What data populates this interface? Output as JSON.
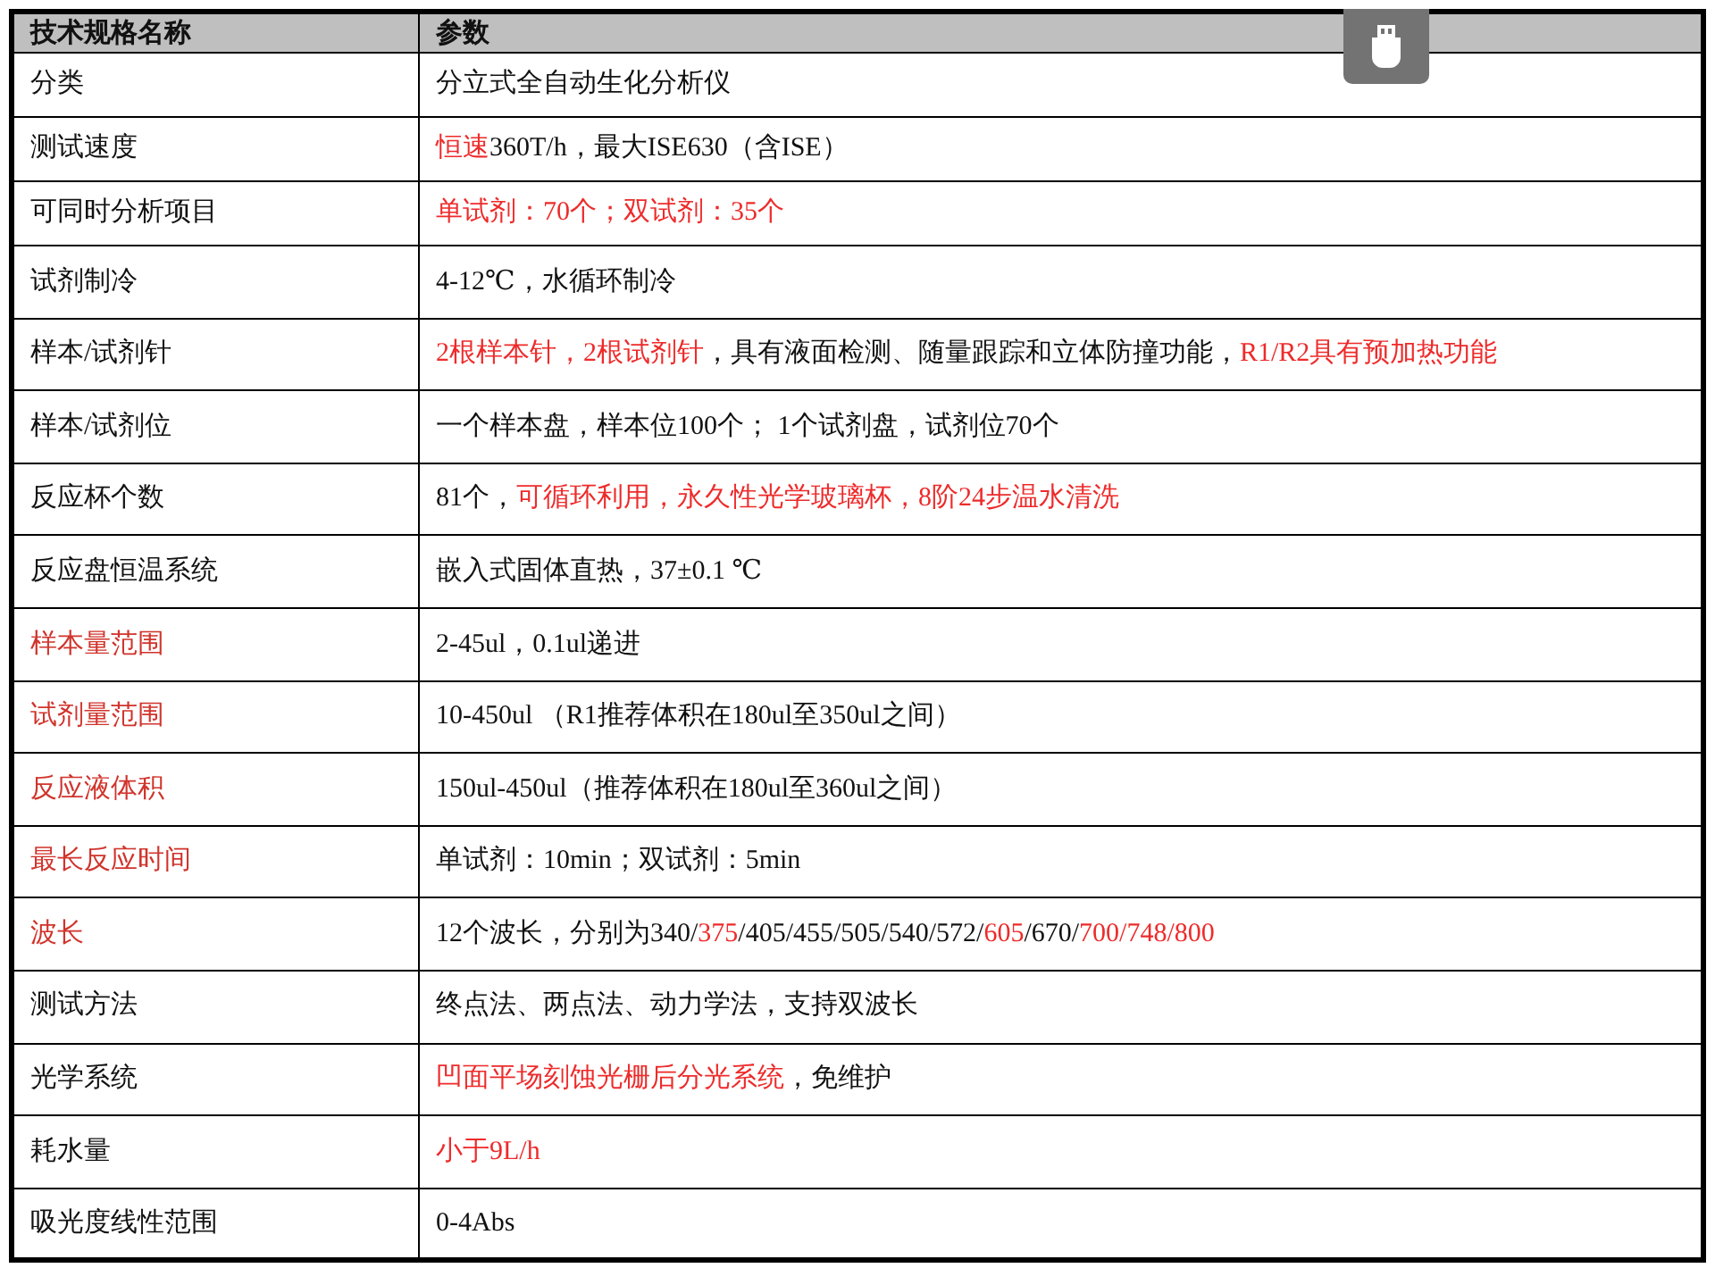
{
  "table": {
    "columns": [
      "技术规格名称",
      "参数"
    ],
    "rows": [
      [
        [
          {
            "text": "分类",
            "highlight": false
          }
        ],
        [
          {
            "text": "分立式全自动生化分析仪",
            "highlight": false
          }
        ]
      ],
      [
        [
          {
            "text": "测试速度",
            "highlight": false
          }
        ],
        [
          {
            "text": "恒速",
            "highlight": true
          },
          {
            "text": "360T/h，最大ISE630（含ISE）",
            "highlight": false
          }
        ]
      ],
      [
        [
          {
            "text": "可同时分析项目",
            "highlight": false
          }
        ],
        [
          {
            "text": "单试剂：70个；双试剂：35个",
            "highlight": true
          }
        ]
      ],
      [
        [
          {
            "text": "试剂制冷",
            "highlight": false
          }
        ],
        [
          {
            "text": "4-12℃，水循环制冷",
            "highlight": false
          }
        ]
      ],
      [
        [
          {
            "text": "样本/试剂针",
            "highlight": false
          }
        ],
        [
          {
            "text": "2根样本针，2根试剂针",
            "highlight": true
          },
          {
            "text": "，具有液面检测、随量跟踪和立体防撞功能，",
            "highlight": false
          },
          {
            "text": "R1/R2具有预加热功能",
            "highlight": true
          }
        ]
      ],
      [
        [
          {
            "text": "样本/试剂位",
            "highlight": false
          }
        ],
        [
          {
            "text": "一个样本盘，样本位100个； 1个试剂盘，试剂位70个",
            "highlight": false
          }
        ]
      ],
      [
        [
          {
            "text": "反应杯个数",
            "highlight": false
          }
        ],
        [
          {
            "text": "81个，",
            "highlight": false
          },
          {
            "text": "可循环利用，永久性光学玻璃杯，8阶24步温水清洗",
            "highlight": true
          }
        ]
      ],
      [
        [
          {
            "text": "反应盘恒温系统",
            "highlight": false
          }
        ],
        [
          {
            "text": "嵌入式固体直热，37±0.1 ℃",
            "highlight": false
          }
        ]
      ],
      [
        [
          {
            "text": "样本量范围",
            "highlight": true
          }
        ],
        [
          {
            "text": "2-45ul，0.1ul递进",
            "highlight": false
          }
        ]
      ],
      [
        [
          {
            "text": "试剂量范围",
            "highlight": true
          }
        ],
        [
          {
            "text": "10-450ul （R1推荐体积在180ul至350ul之间）",
            "highlight": false
          }
        ]
      ],
      [
        [
          {
            "text": "反应液体积",
            "highlight": true
          }
        ],
        [
          {
            "text": "150ul-450ul（推荐体积在180ul至360ul之间）",
            "highlight": false
          }
        ]
      ],
      [
        [
          {
            "text": "最长反应时间",
            "highlight": true
          }
        ],
        [
          {
            "text": "单试剂：10min；双试剂：5min",
            "highlight": false
          }
        ]
      ],
      [
        [
          {
            "text": "波长",
            "highlight": true
          }
        ],
        [
          {
            "text": "12个波长，分别为340/",
            "highlight": false
          },
          {
            "text": "375",
            "highlight": true
          },
          {
            "text": "/405/455/505/540/572/",
            "highlight": false
          },
          {
            "text": "605",
            "highlight": true
          },
          {
            "text": "/670/",
            "highlight": false
          },
          {
            "text": "700/748/800",
            "highlight": true
          }
        ]
      ],
      [
        [
          {
            "text": "测试方法",
            "highlight": false
          }
        ],
        [
          {
            "text": "终点法、两点法、动力学法，支持双波长",
            "highlight": false
          }
        ]
      ],
      [
        [
          {
            "text": "光学系统",
            "highlight": false
          }
        ],
        [
          {
            "text": "凹面平场刻蚀光栅后分光系统",
            "highlight": true
          },
          {
            "text": "，免维护",
            "highlight": false
          }
        ]
      ],
      [
        [
          {
            "text": "耗水量",
            "highlight": false
          }
        ],
        [
          {
            "text": "小于9L/h",
            "highlight": true
          }
        ]
      ],
      [
        [
          {
            "text": "吸光度线性范围",
            "highlight": false
          }
        ],
        [
          {
            "text": "0-4Abs",
            "highlight": false
          }
        ]
      ]
    ]
  }
}
